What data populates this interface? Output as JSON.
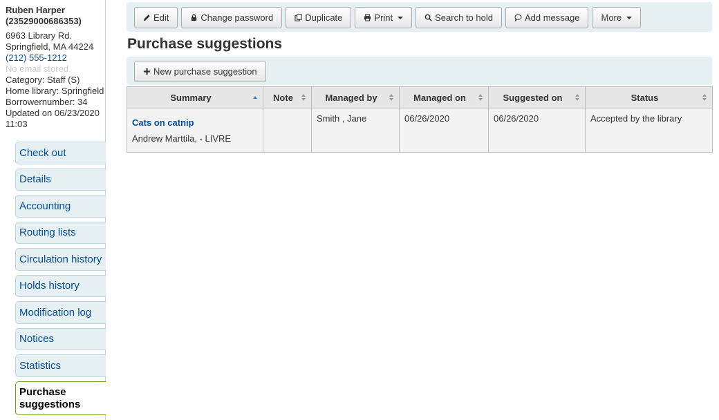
{
  "patron": {
    "name": "Ruben Harper",
    "cardnumber": "(23529000686353)",
    "address1": "6963 Library Rd.",
    "address2": "Springfield, MA 44224",
    "phone": "(212) 555-1212",
    "email": "No email stored.",
    "category": "Category: Staff (S)",
    "home_library": "Home library: Springfield",
    "borrowernumber": "Borrowernumber: 34",
    "updated": "Updated on 06/23/2020",
    "updated_time": "11:03"
  },
  "menu": [
    {
      "label": "Check out"
    },
    {
      "label": "Details"
    },
    {
      "label": "Accounting"
    },
    {
      "label": "Routing lists"
    },
    {
      "label": "Circulation history"
    },
    {
      "label": "Holds history"
    },
    {
      "label": "Modification log"
    },
    {
      "label": "Notices"
    },
    {
      "label": "Statistics"
    },
    {
      "label": "Purchase suggestions",
      "active": true
    }
  ],
  "toolbar": {
    "edit": "Edit",
    "change_password": "Change password",
    "duplicate": "Duplicate",
    "print": "Print",
    "search_to_hold": "Search to hold",
    "add_message": "Add message",
    "more": "More"
  },
  "page_title": "Purchase suggestions",
  "new_suggestion": "New purchase suggestion",
  "table": {
    "headers": [
      "Summary",
      "Note",
      "Managed by",
      "Managed on",
      "Suggested on",
      "Status"
    ],
    "rows": [
      {
        "title": "Cats on catnip",
        "author": "Andrew Marttila, - LIVRE",
        "note": "",
        "managed_by": "Smith , Jane",
        "managed_on": "06/26/2020",
        "suggested_on": "06/26/2020",
        "status": "Accepted by the library"
      }
    ]
  },
  "colors": {
    "link": "#004d99",
    "toolbar_bg": "#e6f0f2",
    "header_bg": "#e6e6e6",
    "active_border": "#6aa31a"
  }
}
